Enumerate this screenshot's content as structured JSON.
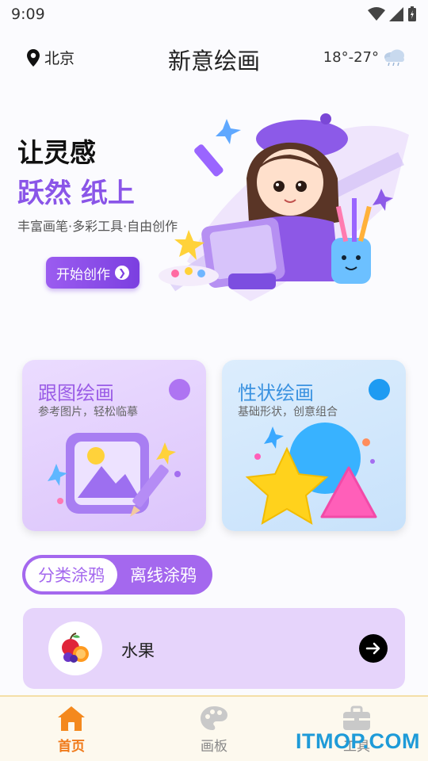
{
  "status_bar": {
    "time": "9:09"
  },
  "header": {
    "location": "北京",
    "title": "新意绘画",
    "weather": "18°-27°"
  },
  "hero": {
    "line1": "让灵感",
    "line2": "跃然 纸上",
    "subtitle": "丰富画笔·多彩工具·自由创作",
    "button_label": "开始创作"
  },
  "cards": [
    {
      "title": "跟图绘画",
      "subtitle": "参考图片，轻松临摹",
      "dot_color": "#ae74f2"
    },
    {
      "title": "性状绘画",
      "subtitle": "基础形状，创意组合",
      "dot_color": "#1e9bf2"
    }
  ],
  "segments": [
    {
      "label": "分类涂鸦",
      "active": true
    },
    {
      "label": "离线涂鸦",
      "active": false
    }
  ],
  "category_list": [
    {
      "label": "水果",
      "icon": "fruit-icon"
    }
  ],
  "tabbar": [
    {
      "label": "首页",
      "icon": "home-icon",
      "active": true
    },
    {
      "label": "画板",
      "icon": "palette-icon",
      "active": false
    },
    {
      "label": "工具",
      "icon": "toolbox-icon",
      "active": false
    }
  ],
  "watermark": "ITMOP.COM",
  "colors": {
    "accent": "#a468ee",
    "tab_active": "#f07a1a",
    "card_blue": "#1e9bf2"
  }
}
